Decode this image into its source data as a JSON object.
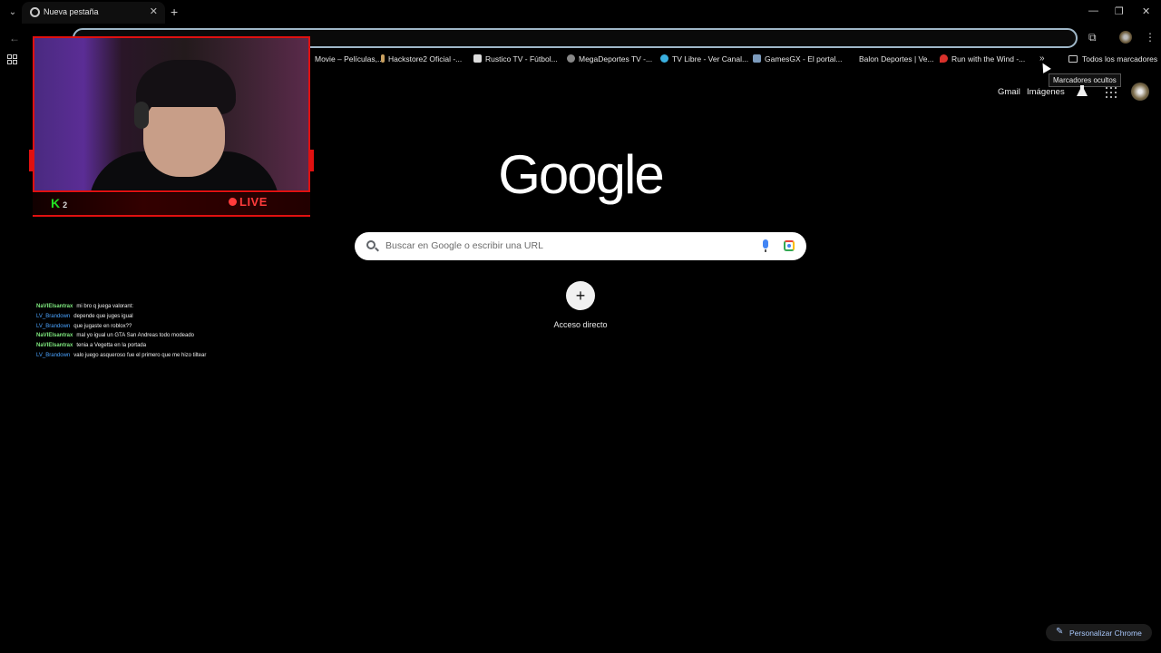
{
  "browser": {
    "tab": {
      "title": "Nueva pestaña",
      "close": "✕"
    },
    "new_tab": "+",
    "window_controls": [
      "—",
      "❐",
      "✕"
    ],
    "back": "←",
    "reload": "↻",
    "menu": "⋮"
  },
  "bookmarks": {
    "items": [
      {
        "label": "Movie – Películas,...",
        "color": "#000000"
      },
      {
        "label": "Hackstore2 Oficial -...",
        "color": "#c9a060"
      },
      {
        "label": "Rustico TV - Fútbol...",
        "color": "#dddddd"
      },
      {
        "label": "MegaDeportes TV -...",
        "color": "#888888"
      },
      {
        "label": "TV Libre - Ver Canal...",
        "color": "#3ab0e0"
      },
      {
        "label": "GamesGX - El portal...",
        "color": "#7c9bbd"
      },
      {
        "label": "Balon Deportes | Ve...",
        "color": "#000000"
      },
      {
        "label": "Run with the Wind -...",
        "color": "#d9312b"
      }
    ],
    "more": "»",
    "all": "Todos los marcadores",
    "tooltip": "Marcadores ocultos"
  },
  "google": {
    "gmail": "Gmail",
    "images": "Imágenes",
    "logo": "Google",
    "search_placeholder": "Buscar en Google o escribir una URL",
    "shortcut_plus": "+",
    "shortcut_label": "Acceso directo",
    "customize": "Personalizar Chrome"
  },
  "stream": {
    "k_letter": "K",
    "k_num": "2",
    "live": "LIVE",
    "chat": [
      {
        "user": "NaVIElsantrax",
        "color": "#7ee87e",
        "msg": "mi bro q juega valorant:"
      },
      {
        "user": "LV_Brandown",
        "color": "#4aa3ff",
        "msg": "depende que juges igual"
      },
      {
        "user": "LV_Brandown",
        "color": "#4aa3ff",
        "msg": "que jugaste en roblox??"
      },
      {
        "user": "NaVIElsantrax",
        "color": "#7ee87e",
        "msg": "mal yo igual un GTA San Andreas todo modeado"
      },
      {
        "user": "NaVIElsantrax",
        "color": "#7ee87e",
        "msg": "tenia a Vegetta en la portada"
      },
      {
        "user": "LV_Brandown",
        "color": "#4aa3ff",
        "msg": "valo juego asqueroso fue el primero que me hizo tiltear"
      }
    ]
  }
}
